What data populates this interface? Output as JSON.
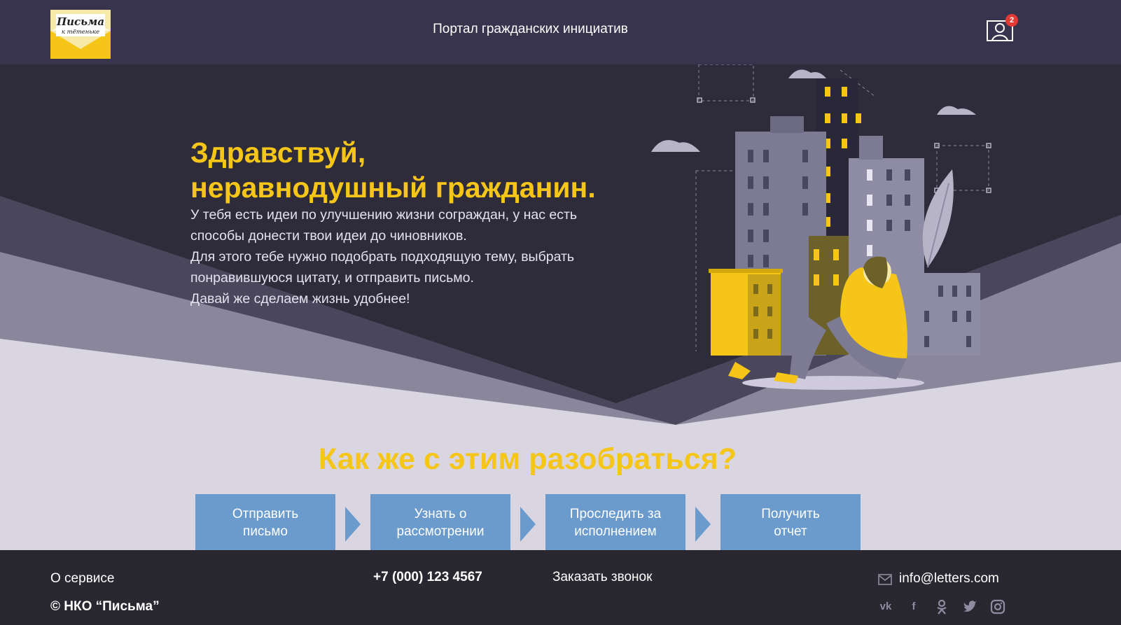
{
  "header": {
    "logo_text_1": "Письма",
    "logo_text_2": "к тётеньке",
    "title": "Портал гражданских инициатив",
    "notifications_count": "2"
  },
  "hero": {
    "title_line1": "Здравствуй,",
    "title_line2": "неравнодушный гражданин.",
    "text_lines": [
      "У тебя есть идеи по улучшению жизни сограждан, у нас есть",
      "способы донести твои идеи до чиновников.",
      "Для этого тебе нужно подобрать подходящую тему, выбрать",
      "понравившуюся цитату, и отправить письмо.",
      "Давай же сделаем жизнь удобнее!"
    ]
  },
  "how": {
    "title": "Как же с этим разобраться?",
    "steps": [
      {
        "line1": "Отправить",
        "line2": "письмо"
      },
      {
        "line1": "Узнать о",
        "line2": "рассмотрении"
      },
      {
        "line1": "Проследить за",
        "line2": "исполнением"
      },
      {
        "line1": "Получить",
        "line2": "отчет"
      }
    ]
  },
  "footer": {
    "about": "О сервисе",
    "copyright": "© НКО “Письма”",
    "phone": "+7 (000) 123 4567",
    "callback": "Заказать звонок",
    "email": "info@letters.com",
    "socials": [
      "vk-icon",
      "facebook-icon",
      "odnoklassniki-icon",
      "twitter-icon",
      "instagram-icon"
    ]
  },
  "colors": {
    "accent_yellow": "#f5c518",
    "header_bg": "#38344d",
    "step_blue": "#6a9bcc"
  }
}
